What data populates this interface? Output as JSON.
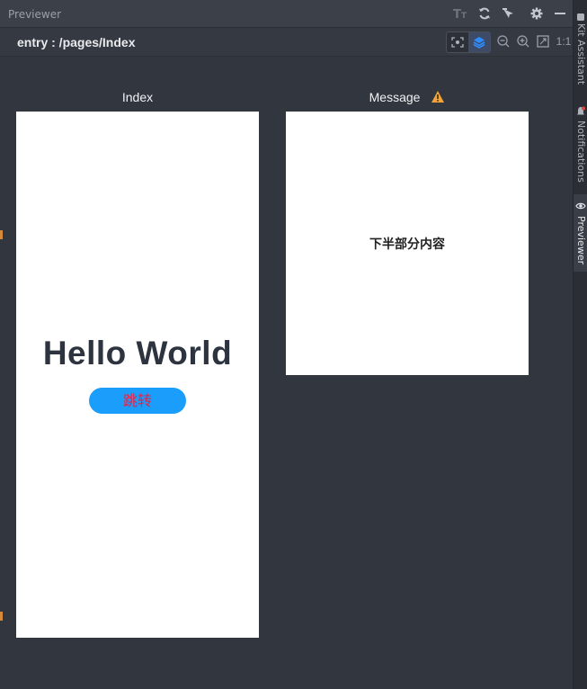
{
  "window": {
    "title": "Previewer"
  },
  "toolbar": {
    "route": "entry : /pages/Index",
    "one_to_one": "1:1"
  },
  "sidebar": {
    "tabs": [
      {
        "label": "Kit Assistant"
      },
      {
        "label": "Notifications"
      },
      {
        "label": "Previewer"
      }
    ]
  },
  "previews": [
    {
      "label": "Index"
    },
    {
      "label": "Message"
    }
  ],
  "index_page": {
    "heading": "Hello World",
    "button_label": "跳转"
  },
  "message_page": {
    "text": "下半部分内容"
  },
  "colors": {
    "accent": "#1a9dfb",
    "button_text": "#e0254a",
    "warning": "#f2a43a",
    "background": "#32363f"
  }
}
